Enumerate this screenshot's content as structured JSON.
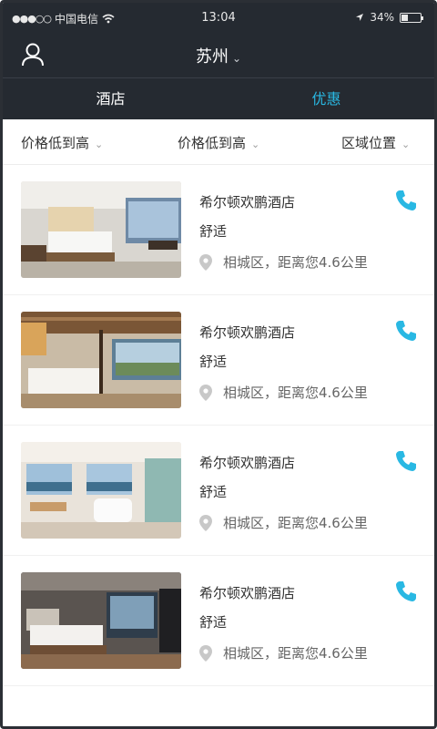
{
  "status_bar": {
    "signal": "●●●○○",
    "carrier": "中国电信",
    "time": "13:04",
    "battery": "34%",
    "battery_level": 0.34
  },
  "header": {
    "city": "苏州",
    "tabs": [
      {
        "label": "酒店",
        "active": false
      },
      {
        "label": "优惠",
        "active": true
      }
    ]
  },
  "filters": {
    "filter_1": "价格低到高",
    "filter_2": "价格低到高",
    "filter_3": "区域位置"
  },
  "hotels": [
    {
      "name": "希尔顿欢鹏酒店",
      "grade": "舒适",
      "location": "相城区，距离您4.6公里"
    },
    {
      "name": "希尔顿欢鹏酒店",
      "grade": "舒适",
      "location": "相城区，距离您4.6公里"
    },
    {
      "name": "希尔顿欢鹏酒店",
      "grade": "舒适",
      "location": "相城区，距离您4.6公里"
    },
    {
      "name": "希尔顿欢鹏酒店",
      "grade": "舒适",
      "location": "相城区，距离您4.6公里"
    }
  ],
  "colors": {
    "header_bg": "#252a31",
    "accent": "#29b8e3",
    "icon_gray": "#c8c8c8"
  }
}
